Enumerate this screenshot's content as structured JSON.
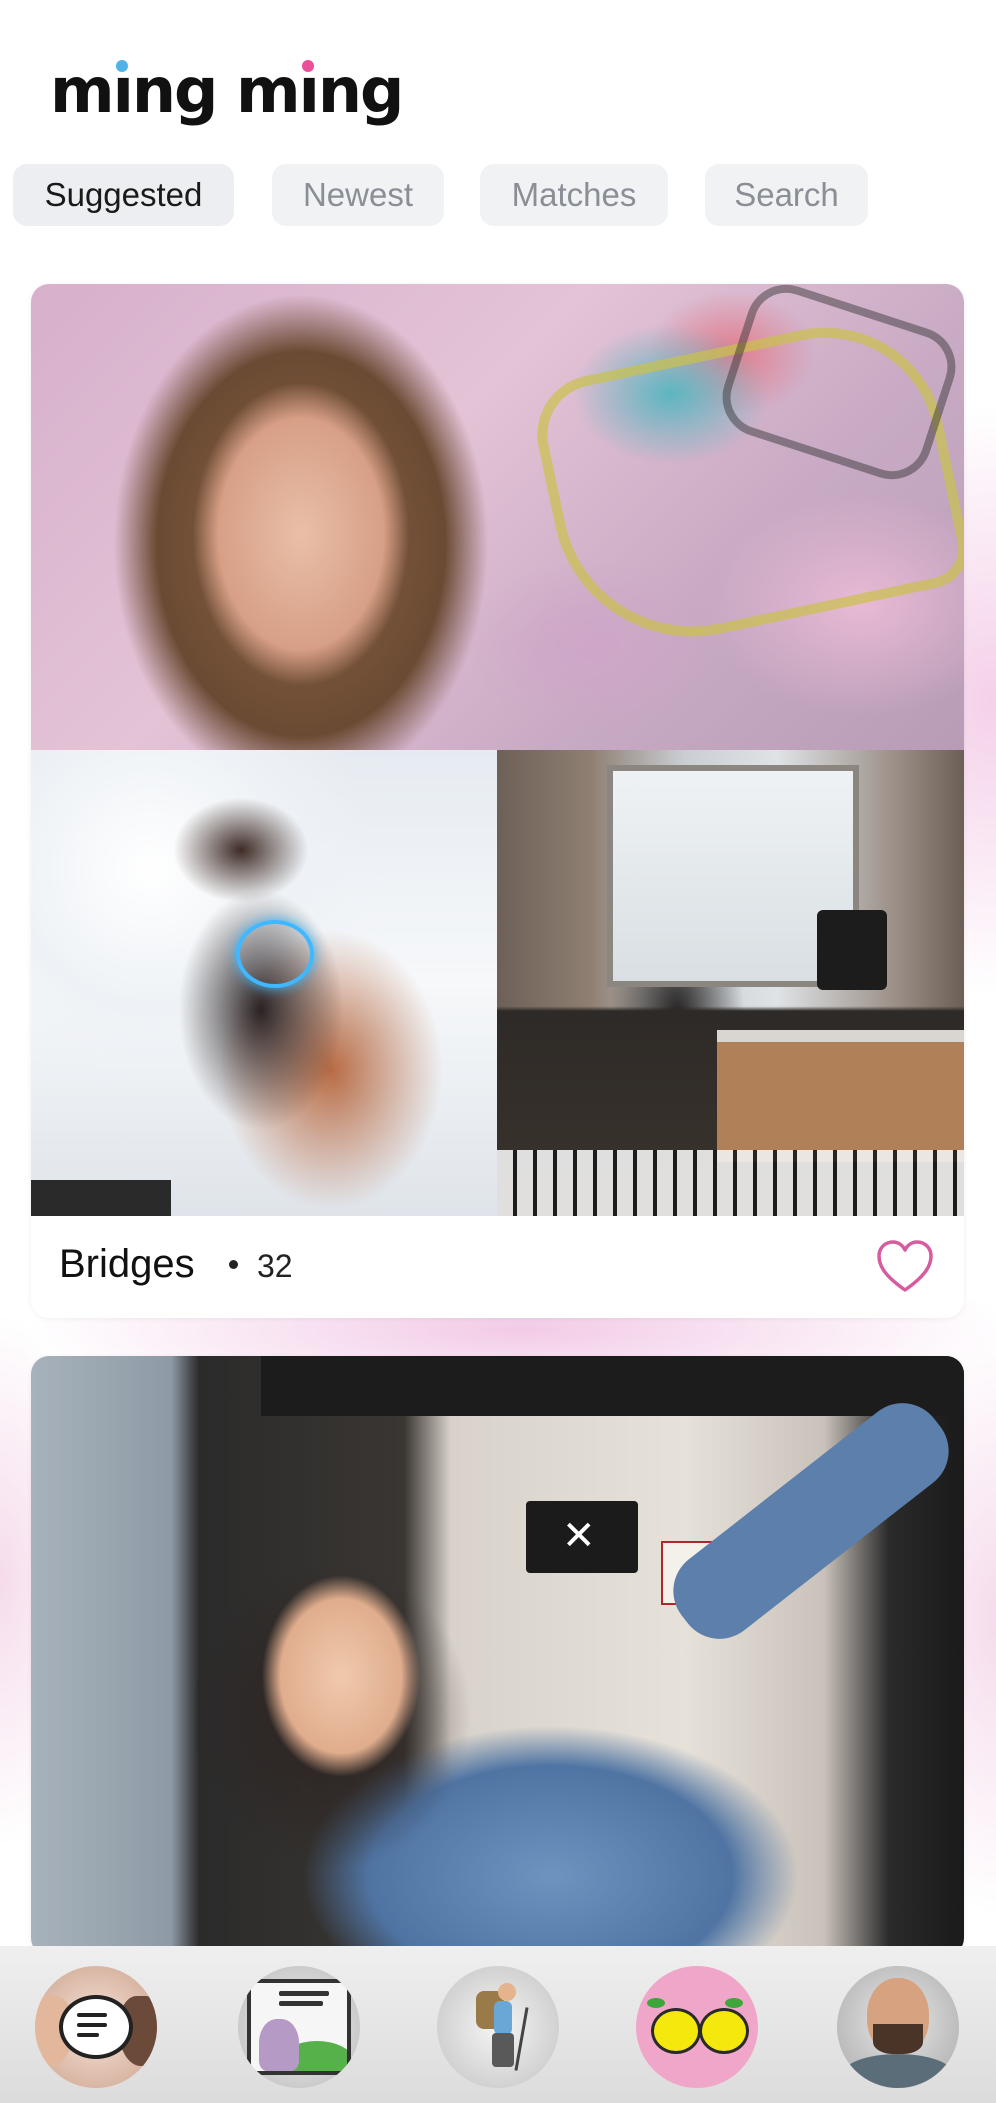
{
  "app": {
    "logo_part1": "m",
    "logo_i1": "ı",
    "logo_part2": "ng m",
    "logo_i2": "ı",
    "logo_part3": "ng",
    "logo_alt": "ming ming",
    "logo_dot_colors": [
      "#4fb3e8",
      "#ec4f9a"
    ]
  },
  "tabs": [
    {
      "label": "Suggested",
      "active": true
    },
    {
      "label": "Newest",
      "active": false
    },
    {
      "label": "Matches",
      "active": false
    },
    {
      "label": "Search",
      "active": false
    }
  ],
  "feed": {
    "cards": [
      {
        "name": "Bridges",
        "age": "32",
        "liked": false,
        "photos": [
          "graffiti-wall-portrait",
          "smoke-dancer-with-glow-necklace",
          "studio-synthesizer-with-headphones"
        ]
      },
      {
        "photos": [
          "storefront-denim-jacket-portrait"
        ]
      }
    ]
  },
  "bottom_nav": {
    "items": [
      {
        "icon": "chat-bubble-icon"
      },
      {
        "icon": "feed-window-icon"
      },
      {
        "icon": "hiker-icon"
      },
      {
        "icon": "lemons-match-icon",
        "active": true
      },
      {
        "icon": "profile-avatar-icon"
      }
    ]
  },
  "colors": {
    "heart_outline": "#d65ca0",
    "active_nav_bg": "#f0a6c8",
    "tab_bg": "#f1f2f4"
  }
}
